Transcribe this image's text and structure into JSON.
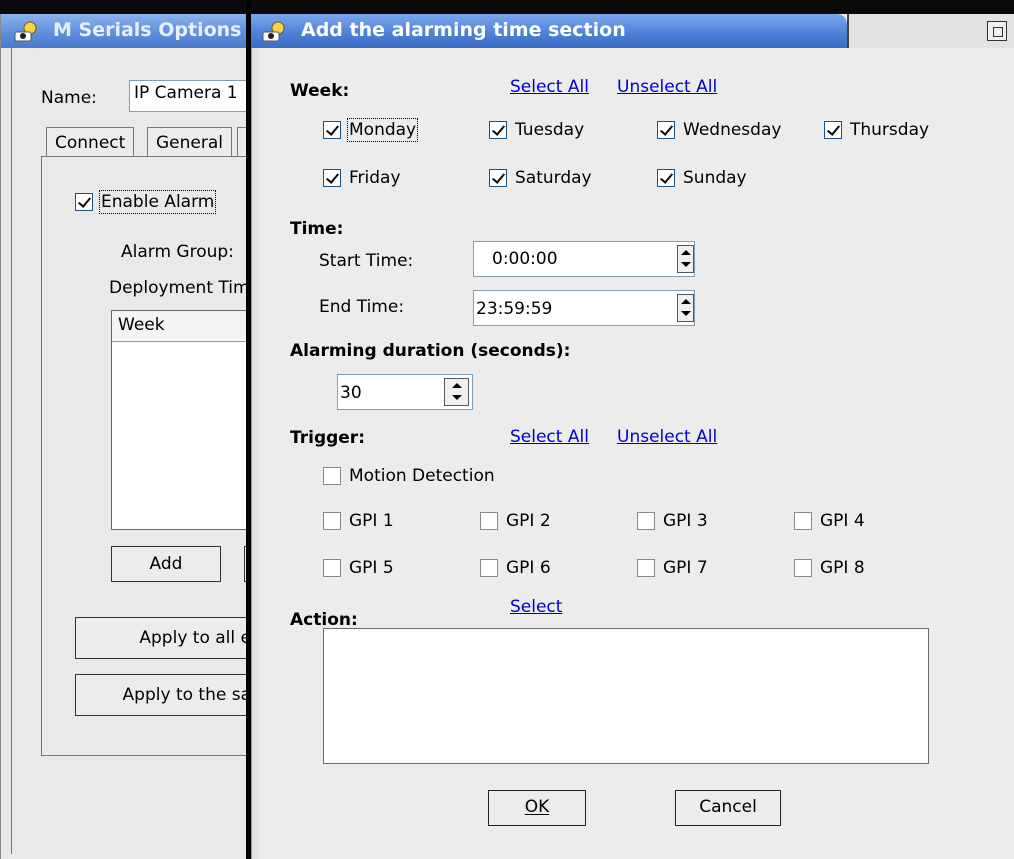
{
  "back_window": {
    "title": "M Serials Options",
    "name_label": "Name:",
    "name_value": "IP Camera 1",
    "tabs": [
      "Connect",
      "General"
    ],
    "enable_alarm_label": "Enable Alarm",
    "enable_alarm_checked": true,
    "alarm_group_label": "Alarm Group:",
    "deployment_time_label": "Deployment Tim",
    "week_column_header": "Week",
    "add_button": "Add",
    "apply_all_button": "Apply to all e",
    "apply_same_button": "Apply to the sa"
  },
  "dialog": {
    "title": "Add the alarming time section",
    "week": {
      "label": "Week:",
      "select_all": "Select All",
      "unselect_all": "Unselect All",
      "days": [
        {
          "label": "Monday",
          "checked": true
        },
        {
          "label": "Tuesday",
          "checked": true
        },
        {
          "label": "Wednesday",
          "checked": true
        },
        {
          "label": "Thursday",
          "checked": true
        },
        {
          "label": "Friday",
          "checked": true
        },
        {
          "label": "Saturday",
          "checked": true
        },
        {
          "label": "Sunday",
          "checked": true
        }
      ]
    },
    "time": {
      "label": "Time:",
      "start_label": "Start Time:",
      "start_value": "0:00:00",
      "end_label": "End Time:",
      "end_value": "23:59:59"
    },
    "duration": {
      "label": "Alarming duration (seconds):",
      "value": "30"
    },
    "trigger": {
      "label": "Trigger:",
      "select_all": "Select All",
      "unselect_all": "Unselect All",
      "motion_detection": "Motion Detection",
      "gpis": [
        "GPI 1",
        "GPI 2",
        "GPI 3",
        "GPI 4",
        "GPI 5",
        "GPI 6",
        "GPI 7",
        "GPI 8"
      ]
    },
    "action": {
      "label": "Action:",
      "select": "Select"
    },
    "ok_button": "OK",
    "cancel_button": "Cancel"
  }
}
